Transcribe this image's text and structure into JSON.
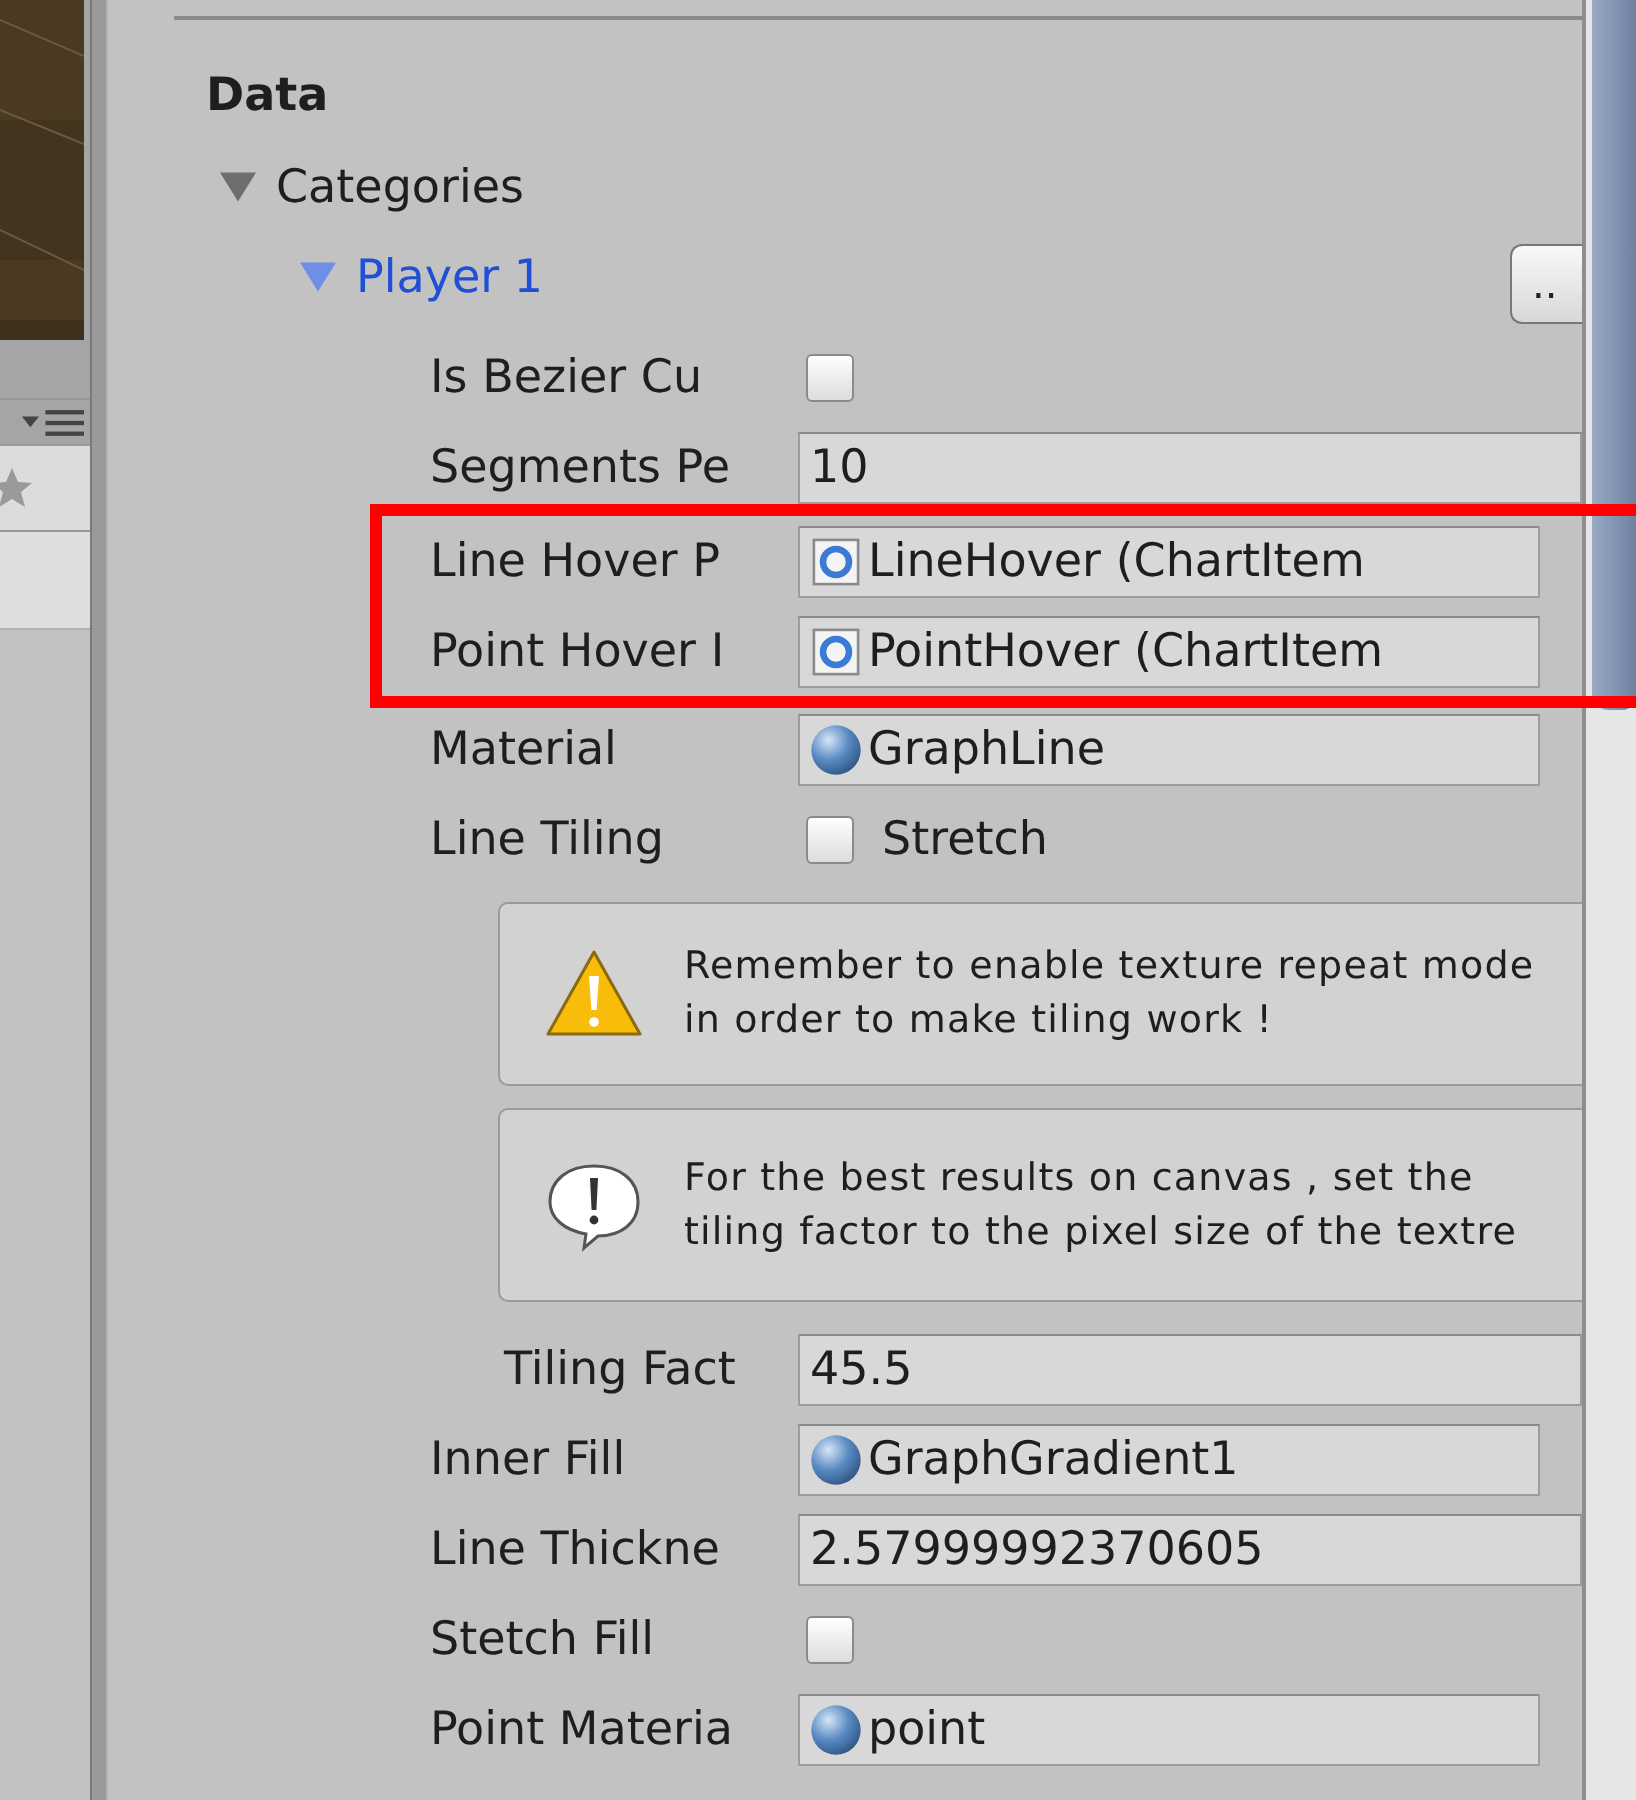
{
  "section_title": "Data",
  "categories": {
    "label": "Categories",
    "expanded": true
  },
  "category": {
    "label": "Player 1",
    "expanded": true,
    "button": ".."
  },
  "fields": [
    {
      "kind": "checkbox",
      "label": "Is Bezier Cu",
      "checked": false,
      "highlighted": false
    },
    {
      "kind": "number",
      "label": "Segments Pe",
      "value": "10",
      "highlighted": false
    },
    {
      "kind": "object",
      "label": "Line Hover P",
      "value": "LineHover (ChartItem",
      "icon": {
        "kind": "prefab"
      },
      "highlighted": true
    },
    {
      "kind": "object",
      "label": "Point Hover I",
      "value": "PointHover (ChartItem",
      "icon": {
        "kind": "prefab"
      },
      "highlighted": true
    },
    {
      "kind": "object",
      "label": "Material",
      "value": "GraphLine",
      "icon": {
        "kind": "material"
      },
      "highlighted": false
    },
    {
      "kind": "toggle",
      "label": "Line Tiling",
      "checked": false,
      "text": "Stretch",
      "highlighted": false
    },
    {
      "kind": "message",
      "icon": {
        "kind": "warning"
      },
      "text": "Remember to enable texture repeat mode in order to make tiling work !",
      "highlighted": false
    },
    {
      "kind": "message",
      "icon": {
        "kind": "info"
      },
      "text": "For the best results on canvas , set the tiling factor to the pixel size of the textre",
      "highlighted": false
    },
    {
      "kind": "number",
      "label": "Tiling Fact",
      "value": "45.5",
      "indented": true,
      "highlighted": false
    },
    {
      "kind": "object",
      "label": "Inner Fill",
      "value": "GraphGradient1",
      "icon": {
        "kind": "material"
      },
      "highlighted": false
    },
    {
      "kind": "number",
      "label": "Line Thickne",
      "value": "2.57999992370605",
      "highlighted": false
    },
    {
      "kind": "checkbox",
      "label": "Stetch Fill",
      "checked": false,
      "highlighted": false
    },
    {
      "kind": "object",
      "label": "Point Materia",
      "value": "point",
      "icon": {
        "kind": "material"
      },
      "highlighted": false
    }
  ]
}
